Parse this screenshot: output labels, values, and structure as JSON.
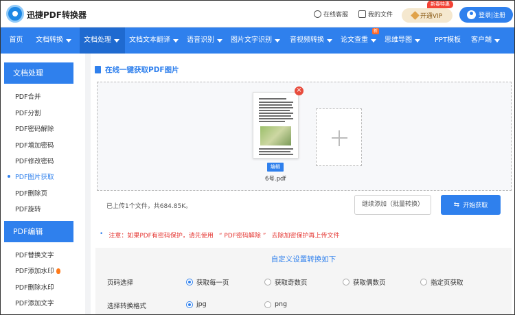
{
  "header": {
    "brand": "迅捷PDF转换器",
    "service": "在线客服",
    "my_files": "我的文件",
    "vip_label": "开通VIP",
    "vip_badge": "新春特惠",
    "login_label": "登录|注册"
  },
  "nav": {
    "items": [
      {
        "label": "首页"
      },
      {
        "label": "文档转换"
      },
      {
        "label": "文档处理"
      },
      {
        "label": "文档文本翻译"
      },
      {
        "label": "语音识别"
      },
      {
        "label": "图片文字识别"
      },
      {
        "label": "音视频转换"
      },
      {
        "label": "论文查重",
        "badge": "新"
      },
      {
        "label": "思维导图"
      },
      {
        "label": "PPT模板"
      },
      {
        "label": "客户端"
      }
    ]
  },
  "sidebar": {
    "section1": "文档处理",
    "items1": [
      "PDF合并",
      "PDF分割",
      "PDF密码解除",
      "PDF增加密码",
      "PDF修改密码",
      "PDF图片获取",
      "PDF删除页",
      "PDF旋转"
    ],
    "section2": "PDF编辑",
    "items2": [
      "PDF替换文字",
      "PDF添加水印",
      "PDF删除水印",
      "PDF添加文字"
    ]
  },
  "main": {
    "title": "在线一键获取PDF图片",
    "file_name": "6号.pdf",
    "edit_label": "编辑",
    "remove_glyph": "×",
    "upload_info": "已上传1个文件，共684.85K。",
    "continue_label": "继续添加（批量转换）",
    "start_label": "开始获取",
    "notice_prefix": "注意：如果PDF有密码保护，请先使用",
    "notice_link": "“ PDF密码解除 ”",
    "notice_suffix": "去除加密保护再上传文件",
    "settings_title": "自定义设置转换如下",
    "page_label": "页码选择",
    "page_options": [
      "获取每一页",
      "获取奇数页",
      "获取偶数页",
      "指定页获取"
    ],
    "page_selected": "获取每一页",
    "format_label": "选择转换格式",
    "format_options": [
      "jpg",
      "png"
    ],
    "format_selected": "jpg"
  },
  "colors": {
    "accent": "#2f80ed",
    "nav_active": "#1f6ad0",
    "warning": "#e53935",
    "vip_bg": "#f5e8cf"
  }
}
